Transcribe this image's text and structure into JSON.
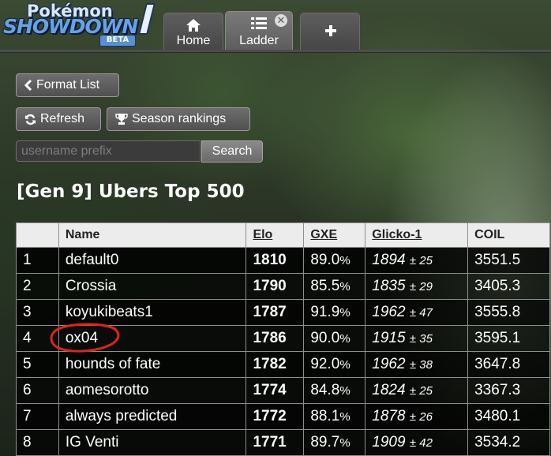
{
  "logo": {
    "line1": "Pokémon",
    "line2": "SHOWDOWN",
    "badge": "BETA"
  },
  "tabs": [
    {
      "label": "Home",
      "icon": "home-icon"
    },
    {
      "label": "Ladder",
      "icon": "list-icon",
      "close": "✕"
    },
    {
      "label": "",
      "icon": "plus-icon"
    }
  ],
  "buttons": {
    "format_list": "Format List",
    "refresh": "Refresh",
    "season_rankings": "Season rankings",
    "search": "Search"
  },
  "search": {
    "placeholder": "username prefix",
    "value": ""
  },
  "title": "[Gen 9] Ubers Top 500",
  "table": {
    "headers": {
      "rank": "",
      "name": "Name",
      "elo": "Elo",
      "gxe": "GXE",
      "glicko": "Glicko-1",
      "coil": "COIL"
    },
    "rows": [
      {
        "rank": "1",
        "name": "default0",
        "elo": "1810",
        "gxe": "89.0",
        "glicko": "1894",
        "dev": "25",
        "coil": "3551.5"
      },
      {
        "rank": "2",
        "name": "Crossia",
        "elo": "1790",
        "gxe": "85.5",
        "glicko": "1835",
        "dev": "29",
        "coil": "3405.3"
      },
      {
        "rank": "3",
        "name": "koyukibeats1",
        "elo": "1787",
        "gxe": "91.9",
        "glicko": "1962",
        "dev": "47",
        "coil": "3555.8"
      },
      {
        "rank": "4",
        "name": "ox04",
        "elo": "1786",
        "gxe": "90.0",
        "glicko": "1915",
        "dev": "35",
        "coil": "3595.1"
      },
      {
        "rank": "5",
        "name": "hounds of fate",
        "elo": "1782",
        "gxe": "92.0",
        "glicko": "1962",
        "dev": "38",
        "coil": "3647.8"
      },
      {
        "rank": "6",
        "name": "aomesorotto",
        "elo": "1774",
        "gxe": "84.8",
        "glicko": "1824",
        "dev": "25",
        "coil": "3367.3"
      },
      {
        "rank": "7",
        "name": "always predicted",
        "elo": "1772",
        "gxe": "88.1",
        "glicko": "1878",
        "dev": "26",
        "coil": "3480.1"
      },
      {
        "rank": "8",
        "name": "IG Venti",
        "elo": "1771",
        "gxe": "89.7",
        "glicko": "1909",
        "dev": "42",
        "coil": "3534.2"
      }
    ],
    "pct_sign": "%",
    "pm_sign": "±"
  },
  "annotation": {
    "highlight_color": "#e0231c"
  }
}
